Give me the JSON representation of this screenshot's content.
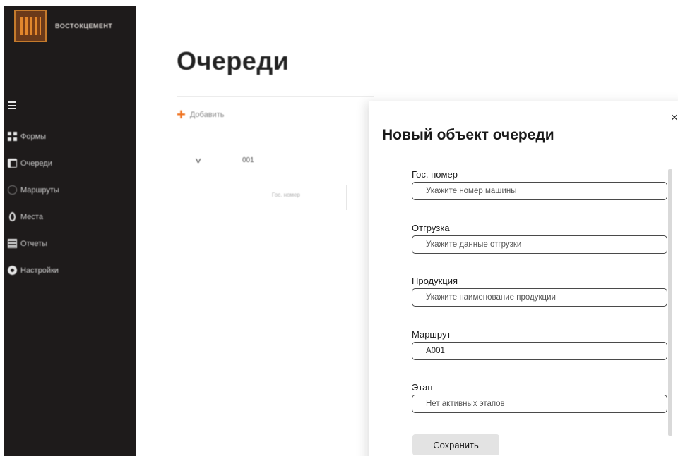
{
  "brand": {
    "name": "ВОСТОКЦЕМЕНТ",
    "logo_icon": "vostokcement-logo"
  },
  "sidebar": {
    "menu_icon": "hamburger-icon",
    "items": [
      {
        "label": "Формы",
        "icon": "grid-icon"
      },
      {
        "label": "Очереди",
        "icon": "document-icon"
      },
      {
        "label": "Маршруты",
        "icon": "route-icon"
      },
      {
        "label": "Места",
        "icon": "location-pin-icon"
      },
      {
        "label": "Отчеты",
        "icon": "list-icon"
      },
      {
        "label": "Настройки",
        "icon": "gear-icon"
      }
    ]
  },
  "main": {
    "title": "Очереди",
    "add_label": "Добавить",
    "row": {
      "id": "001"
    },
    "column_header": "Гос. номер"
  },
  "modal": {
    "title": "Новый объект очереди",
    "close": "×",
    "fields": [
      {
        "label": "Гос. номер",
        "value": "",
        "placeholder": "Укажите номер машины"
      },
      {
        "label": "Отгрузка",
        "value": "",
        "placeholder": "Укажите данные отгрузки"
      },
      {
        "label": "Продукция",
        "value": "",
        "placeholder": "Укажите наименование продукции"
      },
      {
        "label": "Маршрут",
        "value": "А001",
        "placeholder": ""
      },
      {
        "label": "Этап",
        "value": "",
        "placeholder": "Нет активных этапов"
      }
    ],
    "save_label": "Сохранить"
  },
  "colors": {
    "sidebar_bg": "#1e1b1b",
    "accent": "#f07422",
    "button_bg": "#e3e3e3"
  }
}
